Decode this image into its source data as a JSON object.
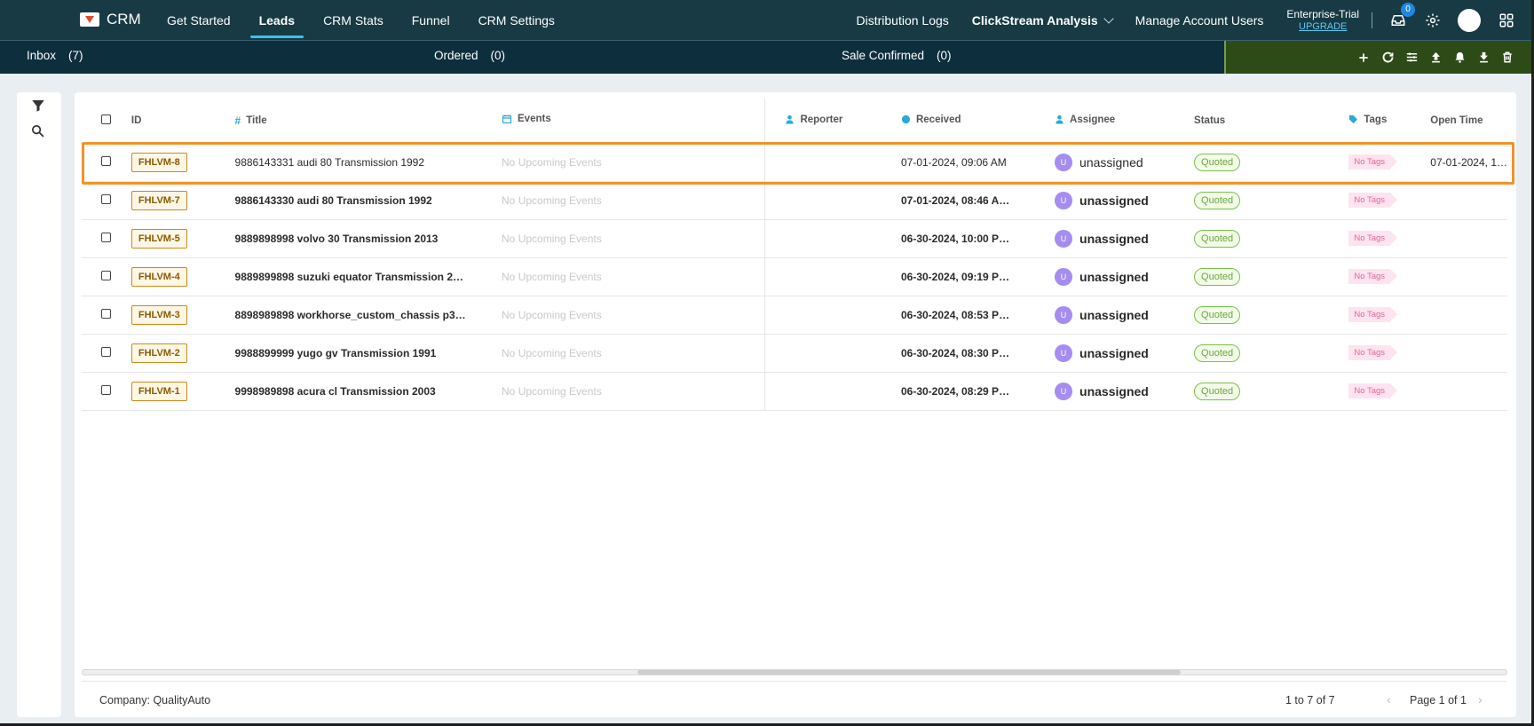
{
  "nav": {
    "brand": "CRM",
    "links": [
      "Get Started",
      "Leads",
      "CRM Stats",
      "Funnel",
      "CRM Settings"
    ],
    "active_link": "Leads",
    "right_links": [
      "Distribution Logs",
      "ClickStream Analysis",
      "Manage Account Users"
    ],
    "plan_name": "Enterprise-Trial",
    "upgrade_label": "UPGRADE",
    "inbox_badge": "0"
  },
  "subtabs": [
    {
      "label": "Inbox",
      "count": "(7)"
    },
    {
      "label": "Ordered",
      "count": "(0)"
    },
    {
      "label": "Sale Confirmed",
      "count": "(0)"
    }
  ],
  "table": {
    "headers": {
      "id": "ID",
      "title": "Title",
      "events": "Events",
      "reporter": "Reporter",
      "received": "Received",
      "assignee": "Assignee",
      "status": "Status",
      "tags": "Tags",
      "open_time": "Open Time"
    },
    "rows": [
      {
        "id": "FHLVM-8",
        "title": "9886143331 audi 80 Transmission 1992",
        "events": "No Upcoming Events",
        "reporter": "",
        "received": "07-01-2024, 09:06 AM",
        "assignee_initial": "U",
        "assignee": "unassigned",
        "status": "Quoted",
        "tags": "No Tags",
        "open_time": "07-01-2024, 1…",
        "bold": false
      },
      {
        "id": "FHLVM-7",
        "title": "9886143330 audi 80 Transmission 1992",
        "events": "No Upcoming Events",
        "reporter": "",
        "received": "07-01-2024, 08:46 A…",
        "assignee_initial": "U",
        "assignee": "unassigned",
        "status": "Quoted",
        "tags": "No Tags",
        "open_time": "",
        "bold": true
      },
      {
        "id": "FHLVM-5",
        "title": "9889898998 volvo 30 Transmission 2013",
        "events": "No Upcoming Events",
        "reporter": "",
        "received": "06-30-2024, 10:00 P…",
        "assignee_initial": "U",
        "assignee": "unassigned",
        "status": "Quoted",
        "tags": "No Tags",
        "open_time": "",
        "bold": true
      },
      {
        "id": "FHLVM-4",
        "title": "9889899898 suzuki equator Transmission 2…",
        "events": "No Upcoming Events",
        "reporter": "",
        "received": "06-30-2024, 09:19 P…",
        "assignee_initial": "U",
        "assignee": "unassigned",
        "status": "Quoted",
        "tags": "No Tags",
        "open_time": "",
        "bold": true
      },
      {
        "id": "FHLVM-3",
        "title": "8898989898 workhorse_custom_chassis p3…",
        "events": "No Upcoming Events",
        "reporter": "",
        "received": "06-30-2024, 08:53 P…",
        "assignee_initial": "U",
        "assignee": "unassigned",
        "status": "Quoted",
        "tags": "No Tags",
        "open_time": "",
        "bold": true
      },
      {
        "id": "FHLVM-2",
        "title": "9988899999 yugo gv Transmission 1991",
        "events": "No Upcoming Events",
        "reporter": "",
        "received": "06-30-2024, 08:30 P…",
        "assignee_initial": "U",
        "assignee": "unassigned",
        "status": "Quoted",
        "tags": "No Tags",
        "open_time": "",
        "bold": true
      },
      {
        "id": "FHLVM-1",
        "title": "9998989898 acura cl Transmission 2003",
        "events": "No Upcoming Events",
        "reporter": "",
        "received": "06-30-2024, 08:29 P…",
        "assignee_initial": "U",
        "assignee": "unassigned",
        "status": "Quoted",
        "tags": "No Tags",
        "open_time": "",
        "bold": true
      }
    ]
  },
  "footer": {
    "company": "Company: QualityAuto",
    "count": "1 to 7 of 7",
    "page": "Page 1 of 1"
  },
  "colors": {
    "nav_bg": "#173a45",
    "subbar_bg": "#0d2e3c",
    "actions_bg": "#2d4b17",
    "highlight": "#f0932b",
    "status_green": "#7cc04a",
    "id_tag": "#c98a1a"
  }
}
